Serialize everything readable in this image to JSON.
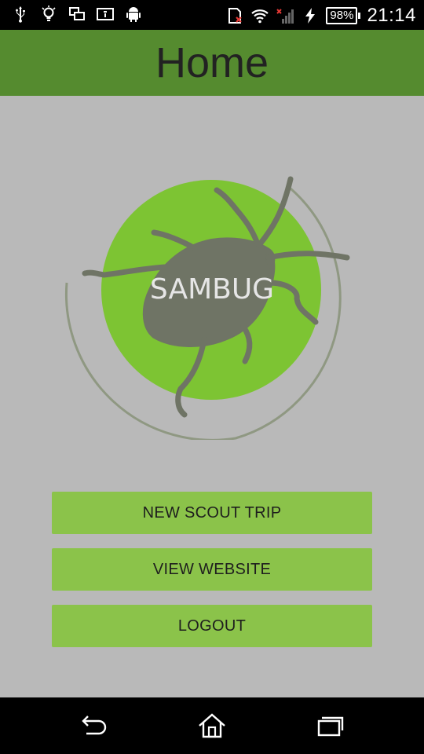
{
  "status_bar": {
    "battery_percent": "98%",
    "time": "21:14",
    "left_icons": [
      "usb-icon",
      "lightbulb-icon",
      "multi-window-icon",
      "image-icon",
      "android-icon"
    ],
    "right_icons": [
      "sim-missing-icon",
      "wifi-icon",
      "signal-off-icon",
      "charging-icon"
    ]
  },
  "action_bar": {
    "title": "Home",
    "color": "#558b2f"
  },
  "logo": {
    "text": "SAMBUG",
    "circle_color": "#7dc433",
    "bug_color": "#6f7465"
  },
  "buttons": [
    {
      "label": "NEW SCOUT TRIP"
    },
    {
      "label": "VIEW WEBSITE"
    },
    {
      "label": "LOGOUT"
    }
  ],
  "button_color": "#8bc34a",
  "nav_bar": {
    "icons": [
      "back-icon",
      "home-icon",
      "recents-icon"
    ]
  }
}
